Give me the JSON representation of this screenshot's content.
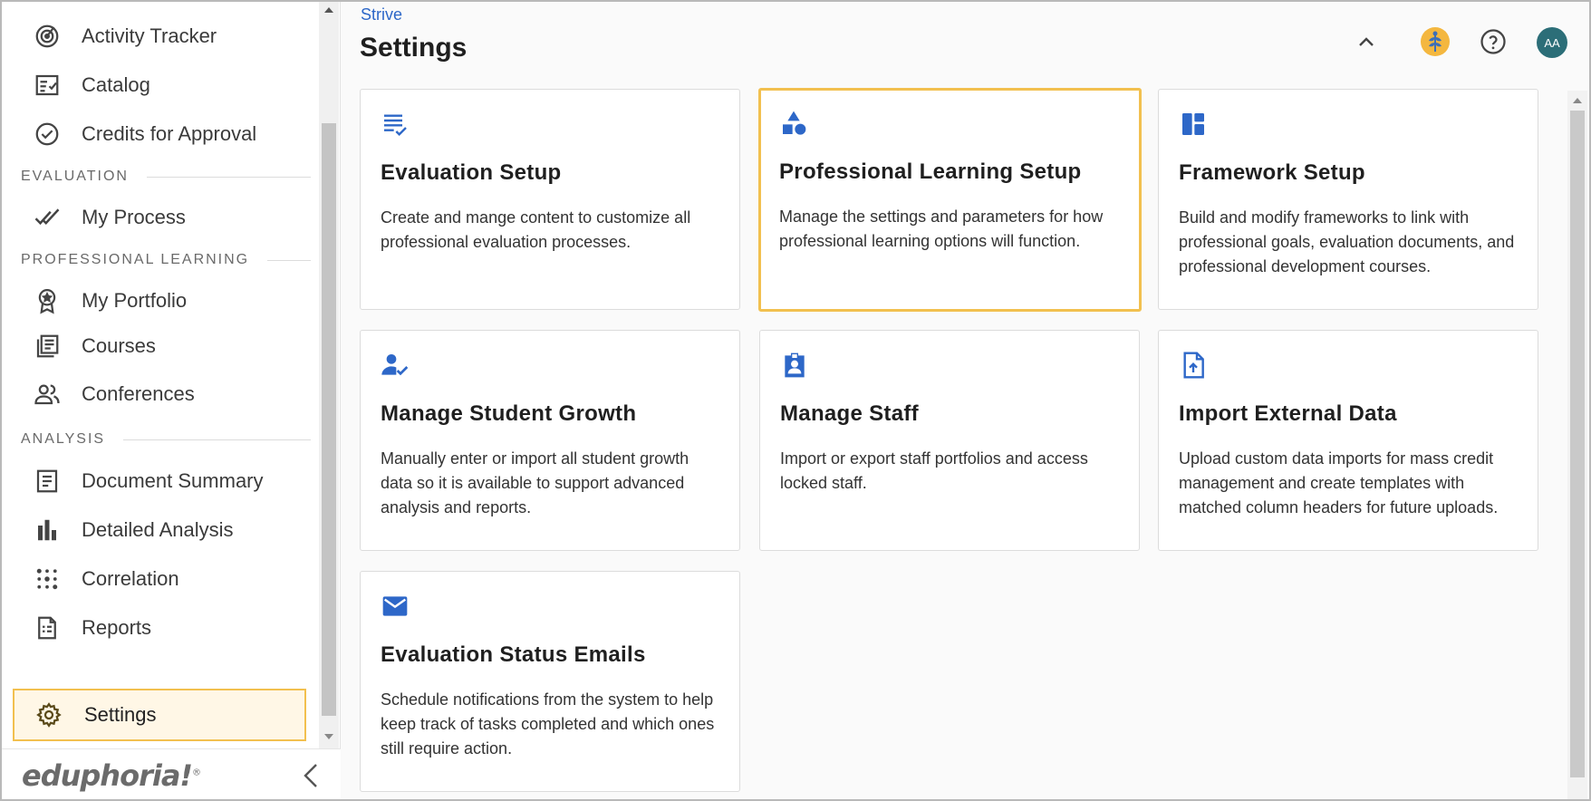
{
  "sidebar": {
    "items_top": [
      {
        "label": "Activity Tracker",
        "icon": "target-icon"
      },
      {
        "label": "Catalog",
        "icon": "checklist-icon"
      },
      {
        "label": "Credits for Approval",
        "icon": "check-circle-icon"
      }
    ],
    "section_evaluation": "EVALUATION",
    "items_evaluation": [
      {
        "label": "My Process",
        "icon": "double-check-icon"
      }
    ],
    "section_professional_learning": "PROFESSIONAL LEARNING",
    "items_professional_learning": [
      {
        "label": "My Portfolio",
        "icon": "award-icon"
      },
      {
        "label": "Courses",
        "icon": "library-icon"
      },
      {
        "label": "Conferences",
        "icon": "people-icon"
      }
    ],
    "section_analysis": "ANALYSIS",
    "items_analysis": [
      {
        "label": "Document Summary",
        "icon": "document-icon"
      },
      {
        "label": "Detailed Analysis",
        "icon": "bar-chart-icon"
      },
      {
        "label": "Correlation",
        "icon": "dots-icon"
      },
      {
        "label": "Reports",
        "icon": "report-icon"
      }
    ],
    "settings_label": "Settings",
    "logo_text": "eduphoria!",
    "logo_mark": "®"
  },
  "header": {
    "breadcrumb": "Strive",
    "title": "Settings",
    "avatar_initials": "AA"
  },
  "cards": [
    {
      "title": "Evaluation Setup",
      "description": "Create and mange content to customize all professional evaluation processes.",
      "icon": "list-check-icon"
    },
    {
      "title": "Professional Learning Setup",
      "description": "Manage the settings and parameters for how professional learning options will function.",
      "icon": "shapes-icon",
      "selected": true
    },
    {
      "title": "Framework Setup",
      "description": "Build and modify frameworks to link with professional goals, evaluation documents, and professional development courses.",
      "icon": "dashboard-icon"
    },
    {
      "title": "Manage Student Growth",
      "description": "Manually enter or import all student growth data so it is available to support advanced analysis and reports.",
      "icon": "person-check-icon"
    },
    {
      "title": "Manage Staff",
      "description": "Import or export staff portfolios and access locked staff.",
      "icon": "badge-icon"
    },
    {
      "title": "Import External Data",
      "description": "Upload custom data imports for mass credit management and create templates with matched column headers for future uploads.",
      "icon": "file-upload-icon"
    },
    {
      "title": "Evaluation Status Emails",
      "description": "Schedule notifications from the system to help keep track of tasks completed and which ones still require action.",
      "icon": "mail-icon"
    }
  ],
  "colors": {
    "accent_blue": "#2d67c8",
    "highlight": "#f2c04f",
    "avatar": "#2c6e78"
  }
}
